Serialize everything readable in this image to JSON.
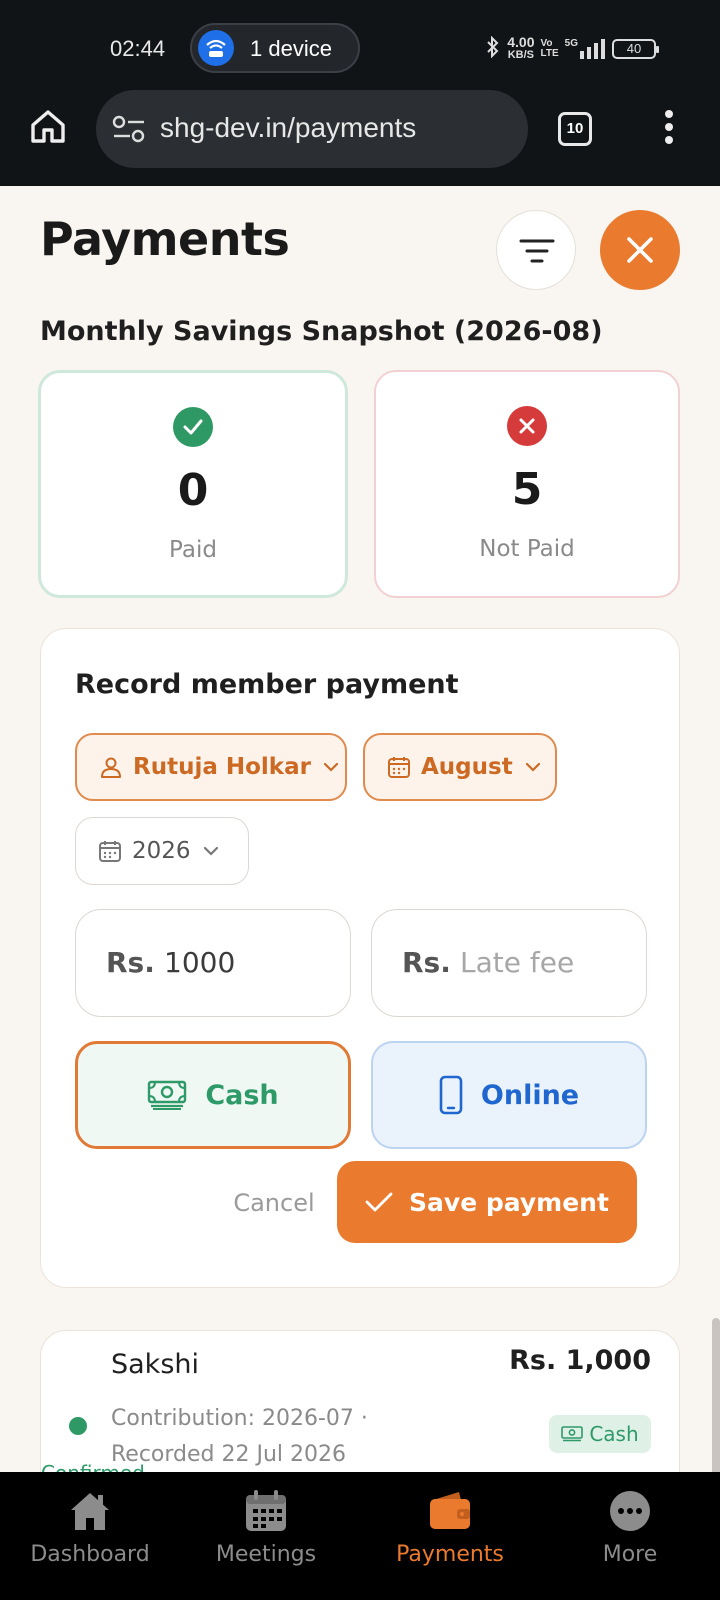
{
  "status_bar": {
    "time": "02:44",
    "hotspot_label": "1 device",
    "net_speed_value": "4.00",
    "net_speed_unit": "KB/S",
    "network_type_top": "Vo",
    "network_type_bottom": "LTE",
    "signal_label": "5G",
    "battery": "40"
  },
  "browser": {
    "url": "shg-dev.in/payments",
    "tab_count": "10"
  },
  "page": {
    "title": "Payments",
    "snapshot_title": "Monthly Savings Snapshot (2026-08)"
  },
  "stats": {
    "paid": {
      "value": "0",
      "label": "Paid"
    },
    "not_paid": {
      "value": "5",
      "label": "Not Paid"
    }
  },
  "record_form": {
    "title": "Record member payment",
    "member": "Rutuja Holkar",
    "month": "August",
    "year": "2026",
    "amount_prefix": "Rs.",
    "amount_value": "1000",
    "late_fee_prefix": "Rs.",
    "late_fee_placeholder": "Late fee",
    "method_cash": "Cash",
    "method_online": "Online",
    "selected_method": "Cash",
    "cancel_label": "Cancel",
    "save_label": "Save payment"
  },
  "payments_list": [
    {
      "name": "Sakshi",
      "meta_line1": "Contribution: 2026-07 ·",
      "meta_line2": "Recorded 22 Jul 2026",
      "amount": "Rs. 1,000",
      "method": "Cash",
      "status": "Confirmed"
    }
  ],
  "bottom_nav": [
    {
      "label": "Dashboard",
      "icon": "home-icon",
      "active": false
    },
    {
      "label": "Meetings",
      "icon": "calendar-icon",
      "active": false
    },
    {
      "label": "Payments",
      "icon": "wallet-icon",
      "active": true
    },
    {
      "label": "More",
      "icon": "more-icon",
      "active": false
    }
  ],
  "colors": {
    "accent": "#ea7a2e",
    "paid_green": "#2f9965",
    "not_paid_red": "#d63b3b",
    "online_blue": "#1f67cf",
    "background": "#f9f5f1"
  }
}
